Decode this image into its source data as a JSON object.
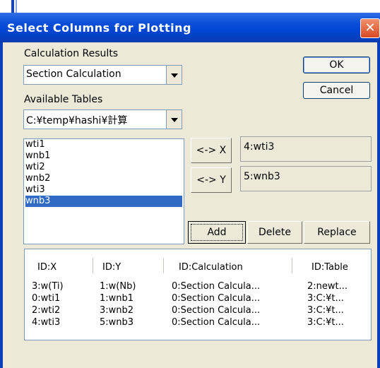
{
  "dialog": {
    "title": "Select Columns for Plotting",
    "close_icon": "close-icon"
  },
  "calculation_results": {
    "label": "Calculation Results",
    "value": "Section Calculation"
  },
  "available_tables": {
    "label": "Available Tables",
    "value": "C:¥temp¥hashi¥計算"
  },
  "buttons": {
    "ok": "OK",
    "cancel": "Cancel",
    "assign_x": "<-> X",
    "assign_y": "<-> Y",
    "add": "Add",
    "delete": "Delete",
    "replace": "Replace"
  },
  "x_value": "4:wti3",
  "y_value": "5:wnb3",
  "columns_list": {
    "items": [
      "wti1",
      "wnb1",
      "wti2",
      "wnb2",
      "wti3",
      "wnb3"
    ],
    "selected": "wnb3"
  },
  "grid": {
    "headers": [
      "ID:X",
      "ID:Y",
      "ID:Calculation",
      "ID:Table"
    ],
    "rows": [
      [
        "3:w(Ti)",
        "1:w(Nb)",
        "0:Section Calcula...",
        "2:newt..."
      ],
      [
        "0:wti1",
        "1:wnb1",
        "0:Section Calcula...",
        "3:C:¥t..."
      ],
      [
        "2:wti2",
        "3:wnb2",
        "0:Section Calcula...",
        "3:C:¥t..."
      ],
      [
        "4:wti3",
        "5:wnb3",
        "0:Section Calcula...",
        "3:C:¥t..."
      ]
    ]
  }
}
